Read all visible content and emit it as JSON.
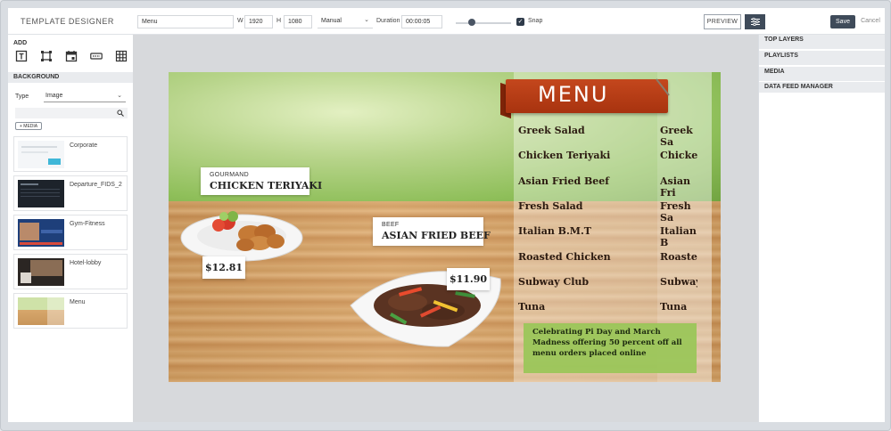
{
  "app": {
    "title": "TEMPLATE DESIGNER"
  },
  "toolbar": {
    "name_value": "Menu",
    "width_label": "W",
    "width_value": "1920",
    "height_label": "H",
    "height_value": "1080",
    "mode_value": "Manual",
    "duration_label": "Duration",
    "duration_value": "00:00:05",
    "slider_level": 0.3,
    "snap_label": "Snap",
    "snap_checked": true,
    "preview_label": "PREVIEW",
    "save_label": "Save",
    "cancel_label": "Cancel"
  },
  "left_panel": {
    "add_label": "ADD",
    "tools": [
      "text-tool-icon",
      "shape-tool-icon",
      "calendar-tool-icon",
      "ticker-tool-icon",
      "grid-tool-icon"
    ],
    "section_title": "BACKGROUND",
    "type_label": "Type",
    "type_value": "Image",
    "media_button": "+ MEDIA",
    "media_items": [
      {
        "name": "Corporate"
      },
      {
        "name": "Departure_FIDS_2"
      },
      {
        "name": "Gym-Fitness"
      },
      {
        "name": "Hotel-lobby"
      },
      {
        "name": "Menu"
      }
    ]
  },
  "canvas": {
    "menu_title": "MENU",
    "menu_items_left": [
      "Greek Salad",
      "Chicken Teriyaki",
      "Asian Fried Beef",
      "Fresh Salad",
      "Italian B.M.T",
      "Roasted Chicken",
      "Subway Club",
      "Tuna"
    ],
    "menu_items_right": [
      "Greek Sa",
      "Chicken",
      "Asian Fri",
      "Fresh Sa",
      "Italian B",
      "Roasted",
      "Subway",
      "Tuna"
    ],
    "promo_text": "Celebrating Pi Day and March Madness offering 50 percent off all menu orders placed online",
    "card1_sub": "GOURMAND",
    "card1_main": "CHICKEN TERIYAKI",
    "card2_sub": "BEEF",
    "card2_main": "ASIAN FRIED BEEF",
    "price1": "$12.81",
    "price2": "$11.90"
  },
  "right_panel": {
    "sections": [
      "TOP LAYERS",
      "PLAYLISTS",
      "MEDIA",
      "DATA FEED MANAGER"
    ]
  },
  "colors": {
    "accent_dark": "#3f4b5a",
    "menu_banner": "#b33a13",
    "promo_green": "#9bc65a"
  }
}
